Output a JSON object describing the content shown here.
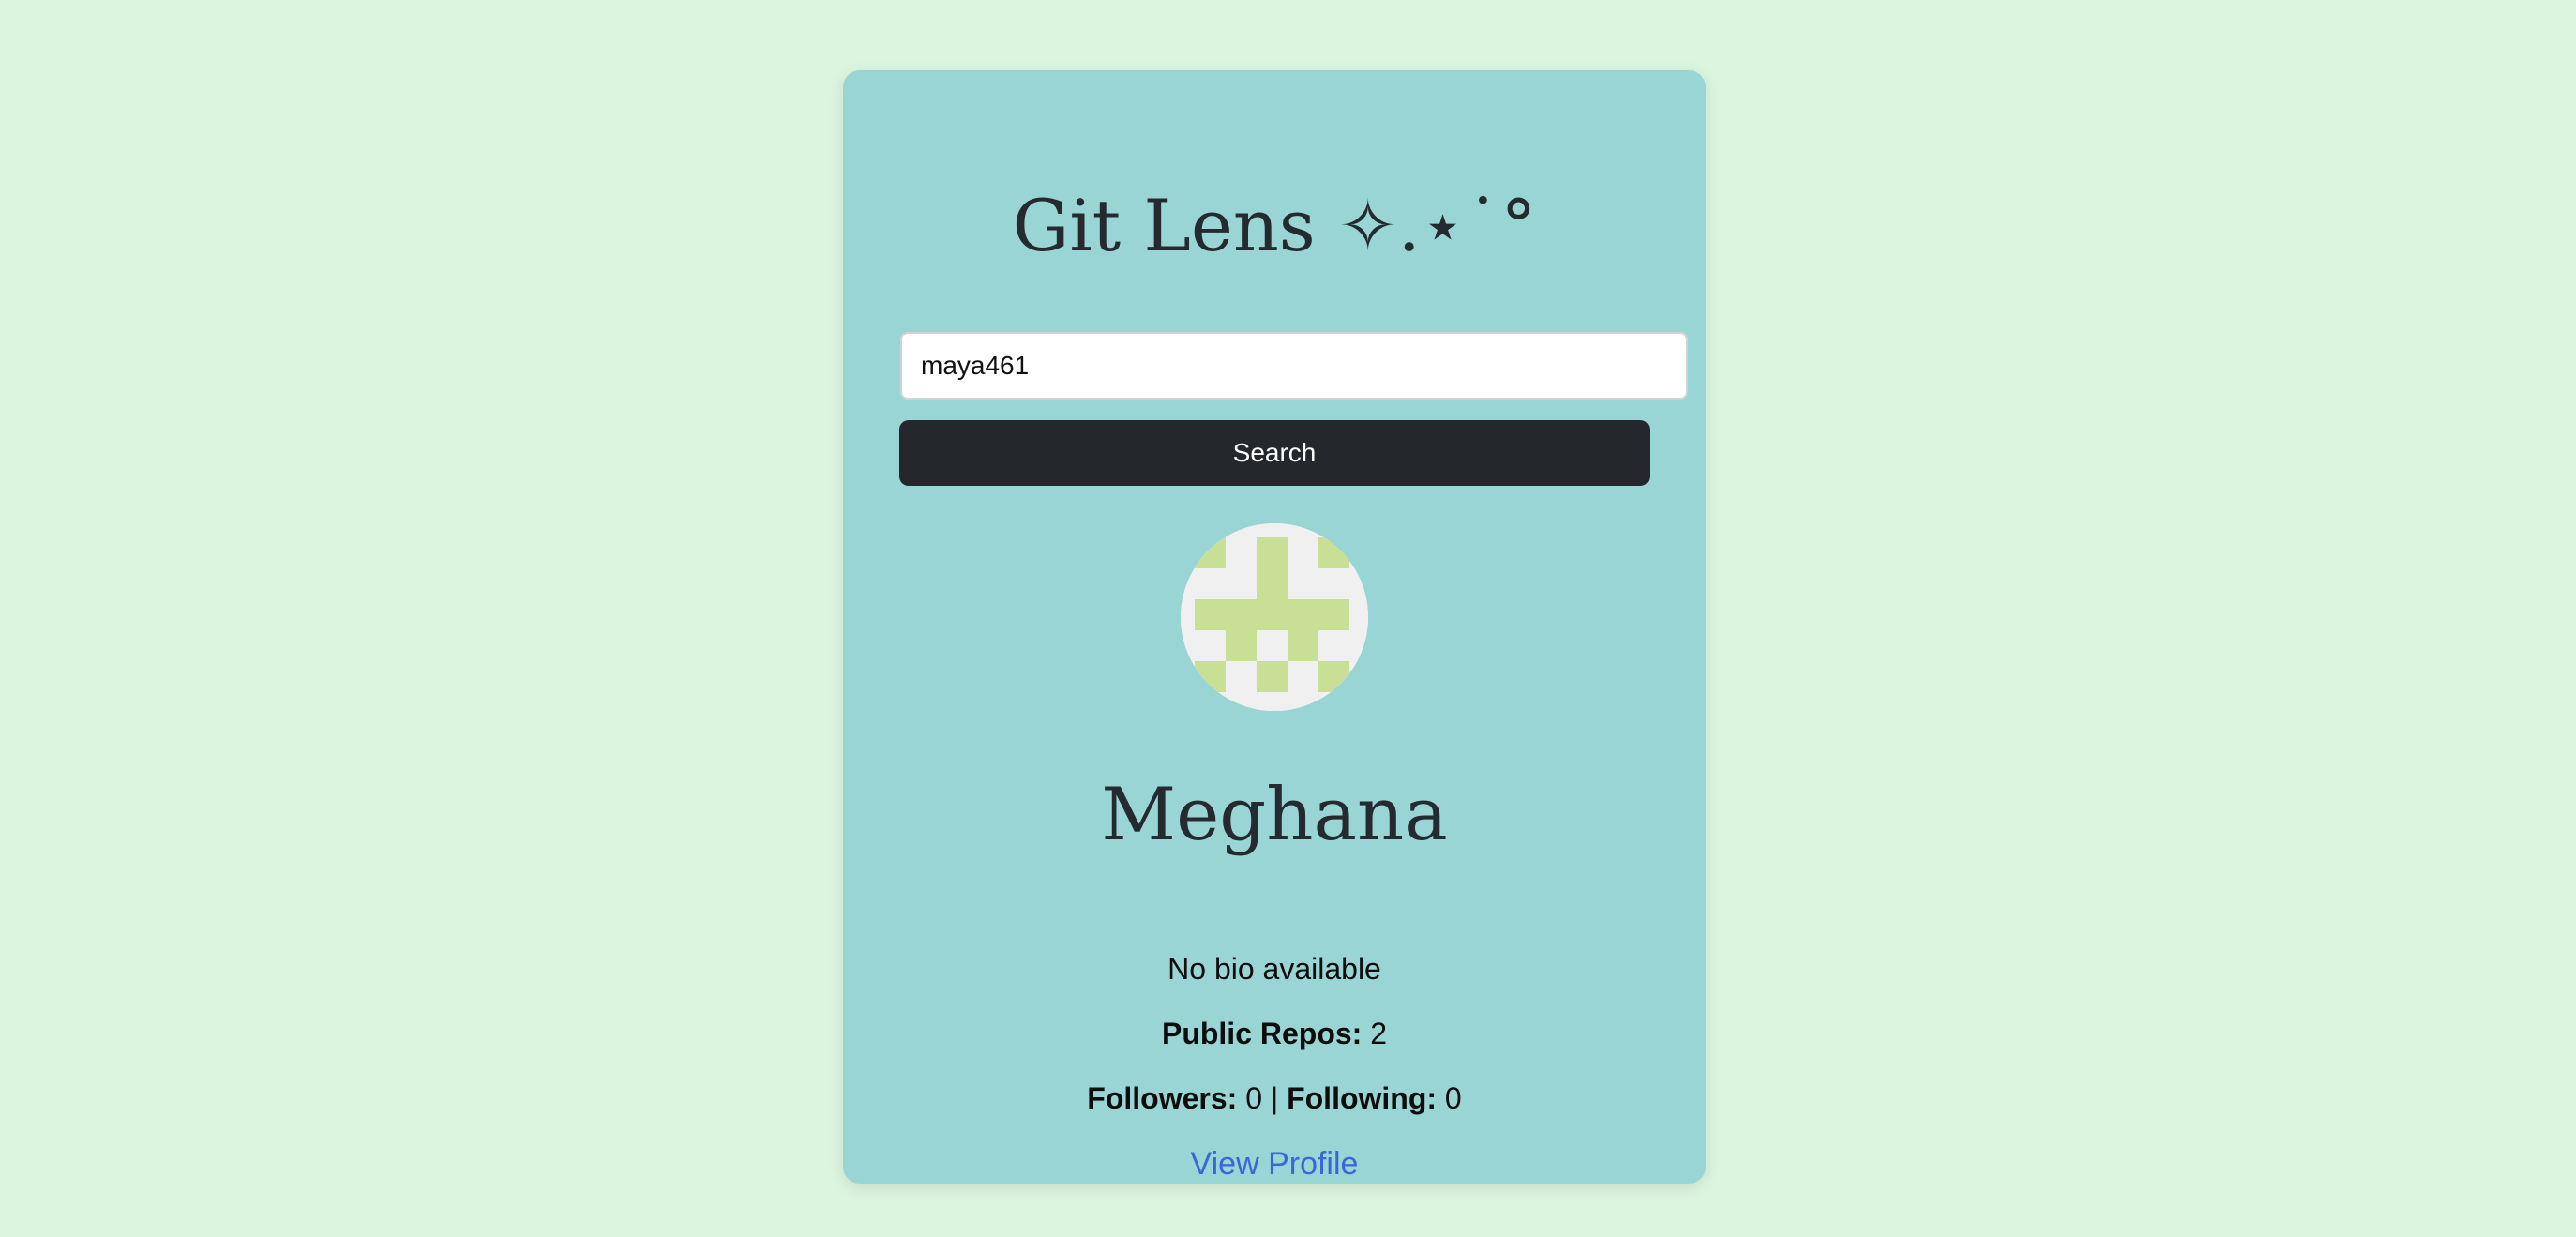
{
  "app": {
    "title": "Git Lens ✧.⋆˙°"
  },
  "search": {
    "value": "maya461",
    "button_label": "Search"
  },
  "profile": {
    "name": "Meghana",
    "bio": "No bio available",
    "public_repos_label": "Public Repos:",
    "public_repos": "2",
    "followers_label": "Followers:",
    "followers": "0",
    "separator": "|",
    "following_label": "Following:",
    "following": "0",
    "view_profile_label": "View Profile"
  },
  "colors": {
    "background": "#dbf5de",
    "card": "#9ad5d6",
    "button": "#24282d",
    "link": "#3a66d6",
    "avatar_pattern": "#c9df95",
    "avatar_background": "#f0f0f0"
  }
}
